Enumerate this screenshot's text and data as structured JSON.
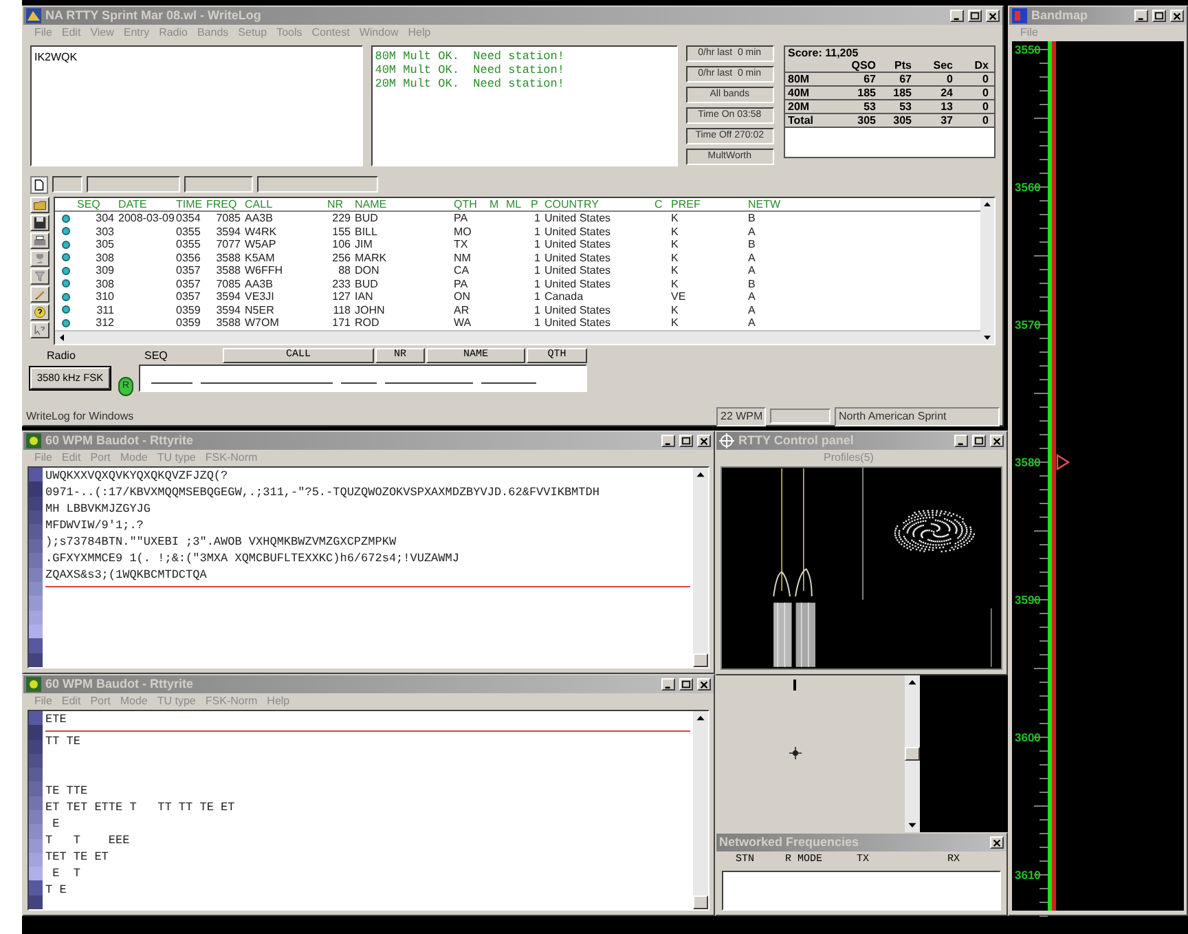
{
  "main_window": {
    "title": "NA RTTY Sprint Mar 08.wl - WriteLog",
    "menu": [
      "File",
      "Edit",
      "View",
      "Entry",
      "Radio",
      "Bands",
      "Setup",
      "Tools",
      "Contest",
      "Window",
      "Help"
    ],
    "callsign_entry": "IK2WQK",
    "mult_messages": [
      "80M Mult OK.  Need station!",
      "40M Mult OK.  Need station!",
      "20M Mult OK.  Need station!"
    ],
    "rate_buttons": [
      "0/hr last  0 min",
      "0/hr last  0 min",
      "All bands",
      "Time On 03:58",
      "Time Off 270:02",
      "MultWorth"
    ],
    "score": {
      "title": "Score: 11,205",
      "columns": [
        "",
        "QSO",
        "Pts",
        "Sec",
        "Dx"
      ],
      "rows": [
        [
          "80M",
          "67",
          "67",
          "0",
          "0"
        ],
        [
          "40M",
          "185",
          "185",
          "24",
          "0"
        ],
        [
          "20M",
          "53",
          "53",
          "13",
          "0"
        ],
        [
          "Total",
          "305",
          "305",
          "37",
          "0"
        ]
      ]
    },
    "log": {
      "columns": [
        "SEQ",
        "DATE",
        "TIME",
        "FREQ",
        "CALL",
        "NR",
        "NAME",
        "QTH",
        "M",
        "ML",
        "P",
        "COUNTRY",
        "C",
        "PREF",
        "NETW"
      ],
      "rows": [
        {
          "seq": "304",
          "date": "2008-03-09",
          "time": "0354",
          "freq": "7085",
          "call": "AA3B",
          "nr": "229",
          "name": "BUD",
          "qth": "PA",
          "p": "1",
          "country": "United States",
          "pref": "K",
          "netw": "B"
        },
        {
          "seq": "303",
          "time": "0355",
          "freq": "3594",
          "call": "W4RK",
          "nr": "155",
          "name": "BILL",
          "qth": "MO",
          "p": "1",
          "country": "United States",
          "pref": "K",
          "netw": "A"
        },
        {
          "seq": "305",
          "time": "0355",
          "freq": "7077",
          "call": "W5AP",
          "nr": "106",
          "name": "JIM",
          "qth": "TX",
          "p": "1",
          "country": "United States",
          "pref": "K",
          "netw": "B"
        },
        {
          "seq": "308",
          "time": "0356",
          "freq": "3588",
          "call": "K5AM",
          "nr": "256",
          "name": "MARK",
          "qth": "NM",
          "p": "1",
          "country": "United States",
          "pref": "K",
          "netw": "A"
        },
        {
          "seq": "309",
          "time": "0357",
          "freq": "3588",
          "call": "W6FFH",
          "nr": "88",
          "name": "DON",
          "qth": "CA",
          "p": "1",
          "country": "United States",
          "pref": "K",
          "netw": "A"
        },
        {
          "seq": "308",
          "time": "0357",
          "freq": "7085",
          "call": "AA3B",
          "nr": "233",
          "name": "BUD",
          "qth": "PA",
          "p": "1",
          "country": "United States",
          "pref": "K",
          "netw": "B"
        },
        {
          "seq": "310",
          "time": "0357",
          "freq": "3594",
          "call": "VE3JI",
          "nr": "127",
          "name": "IAN",
          "qth": "ON",
          "p": "1",
          "country": "Canada",
          "pref": "VE",
          "netw": "A"
        },
        {
          "seq": "311",
          "time": "0359",
          "freq": "3594",
          "call": "N5ER",
          "nr": "118",
          "name": "JOHN",
          "qth": "AR",
          "p": "1",
          "country": "United States",
          "pref": "K",
          "netw": "A"
        },
        {
          "seq": "312",
          "time": "0359",
          "freq": "3588",
          "call": "W7OM",
          "nr": "171",
          "name": "ROD",
          "qth": "WA",
          "p": "1",
          "country": "United States",
          "pref": "K",
          "netw": "A"
        }
      ]
    },
    "entry": {
      "radio_label": "Radio",
      "radio_button": {
        "label": "3580 kHz FSK",
        "default": true
      },
      "radio_indicator": "R",
      "seq_label": "SEQ",
      "fields": [
        "CALL",
        "NR",
        "NAME",
        "QTH"
      ]
    },
    "status_bar": [
      "WriteLog for Windows",
      "22 WPM",
      "North American Sprint"
    ]
  },
  "rttyrite_windows": [
    {
      "title": "60 WPM Baudot - Rttyrite",
      "menu": [
        "File",
        "Edit",
        "Port",
        "Mode",
        "TU type",
        "FSK-Norm"
      ],
      "received": [
        "UWQKXXVQXQVKYQXQKQVZFJZQ(?",
        "0971-..(:17/KBVXMQQMSEBQGEGW,.;311,-\"?5.-TQUZQWOZOKVSPXAXMDZBYVJD.62&FVVIKBMTDH",
        "MH LBBVKMJZGYJG",
        "MFDWVIW/9'1;.?",
        ");s73784BTN.\"\"UXEBI ;3\".AWOB VXHQMKBWZVMZGXCPZMPKW",
        ".GFXYXMMCE9 1(. !;&:(\"3MXA XQMCBUFLTEXXKC)h6/672s4;!VUZAWMJ",
        "ZQAXS&s3;(1WQKBCMTDCTQA"
      ]
    },
    {
      "title": "60 WPM Baudot - Rttyrite",
      "menu": [
        "File",
        "Edit",
        "Port",
        "Mode",
        "TU type",
        "FSK-Norm",
        "Help"
      ],
      "received": [
        "ETE"
      ],
      "transmit": [
        "TT TE",
        {
          "kind": "blank"
        },
        {
          "kind": "blank"
        },
        "TE TTE",
        "ET TET ETTE T   TT TT TE ET",
        " E",
        "T   T    EEE",
        "TET TE ET",
        " E  T",
        "T E"
      ]
    }
  ],
  "control_panel": {
    "title": "RTTY Control panel",
    "menu": [
      "Profiles(5)"
    ]
  },
  "networked_frequencies": {
    "title": "Networked Frequencies",
    "columns": [
      "STN",
      "R MODE",
      "TX",
      "RX"
    ]
  },
  "bandmap": {
    "title": "Bandmap",
    "menu": [
      "File"
    ],
    "scale": [
      {
        "label": "3550",
        "marker": false
      },
      {
        "label": "3560",
        "marker": false
      },
      {
        "label": "3570",
        "marker": false
      },
      {
        "label": "3580",
        "marker": true
      },
      {
        "label": "3590",
        "marker": false
      },
      {
        "label": "3600",
        "marker": false
      },
      {
        "label": "3610",
        "marker": false
      }
    ]
  }
}
